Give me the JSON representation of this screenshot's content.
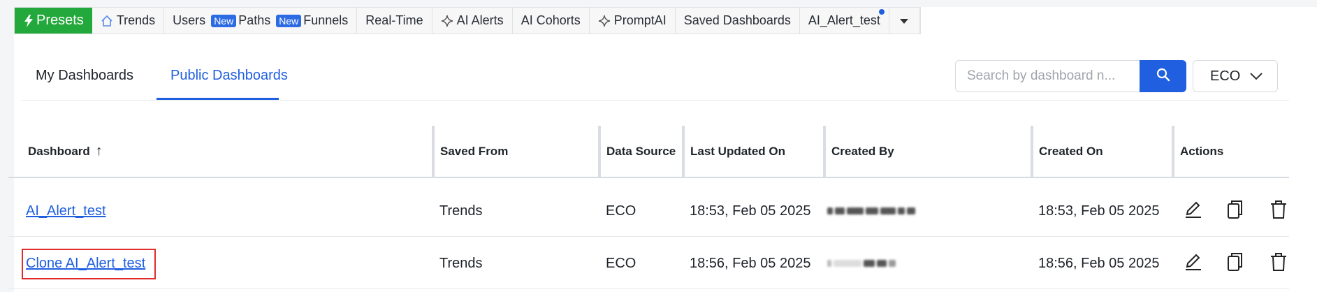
{
  "nav": {
    "presets": "Presets",
    "trends": "Trends",
    "users": "Users",
    "new_badge": "New",
    "paths": "Paths",
    "funnels": "Funnels",
    "realtime": "Real-Time",
    "ai_alerts": "AI Alerts",
    "ai_cohorts": "AI Cohorts",
    "promptai": "PromptAI",
    "saved_dashboards": "Saved Dashboards",
    "ai_alert_test": "AI_Alert_test"
  },
  "tabs": {
    "my_dashboards": "My Dashboards",
    "public_dashboards": "Public Dashboards"
  },
  "search": {
    "placeholder": "Search by dashboard n..."
  },
  "source_select": {
    "value": "ECO"
  },
  "table": {
    "headers": {
      "dashboard": "Dashboard",
      "sort_arrow": "↑",
      "saved_from": "Saved From",
      "data_source": "Data Source",
      "last_updated_on": "Last Updated On",
      "created_by": "Created By",
      "created_on": "Created On",
      "actions": "Actions"
    },
    "rows": [
      {
        "dashboard": "AI_Alert_test",
        "saved_from": "Trends",
        "data_source": "ECO",
        "last_updated_on": "18:53, Feb 05 2025",
        "created_on": "18:53, Feb 05 2025"
      },
      {
        "dashboard": "Clone AI_Alert_test",
        "saved_from": "Trends",
        "data_source": "ECO",
        "last_updated_on": "18:56, Feb 05 2025",
        "created_on": "18:56, Feb 05 2025"
      }
    ]
  },
  "colors": {
    "accent": "#1f5fe0",
    "presets_green": "#23a83b",
    "highlight_red": "#e02b2b"
  }
}
